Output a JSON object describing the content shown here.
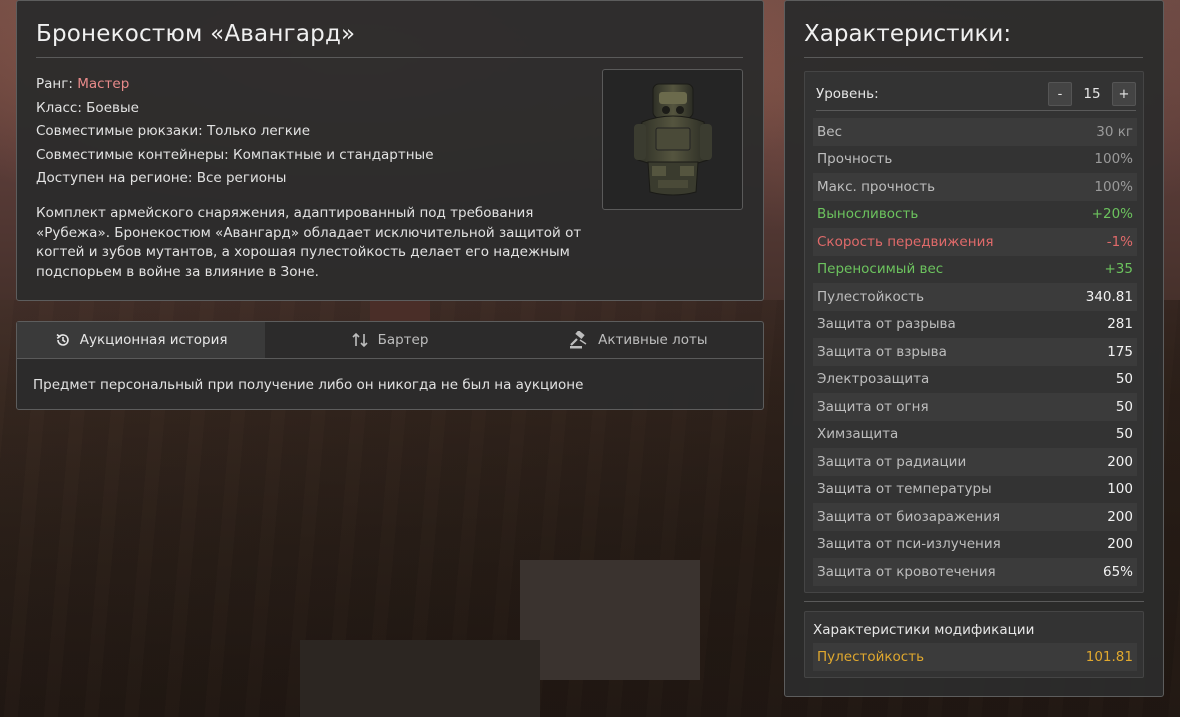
{
  "item": {
    "title": "Бронекостюм «Авангард»",
    "rank_label": "Ранг: ",
    "rank_value": "Мастер",
    "rank_color": "#e88a8a",
    "class_text": "Класс: Боевые",
    "backpacks_text": "Совместимые рюкзаки: Только легкие",
    "containers_text": "Совместимые контейнеры: Компактные и стандартные",
    "region_text": "Доступен на регионе: Все регионы",
    "description": "Комплект армейского снаряжения, адаптированный под требования «Рубежа». Бронекостюм «Авангард» обладает исключительной защитой от когтей и зубов мутантов, а хорошая пулестойкость делает его надежным подспорьем в войне за влияние в Зоне."
  },
  "tabs": [
    {
      "label": "Аукционная история",
      "icon": "history-icon"
    },
    {
      "label": "Бартер",
      "icon": "swap-arrows-icon"
    },
    {
      "label": "Активные лоты",
      "icon": "gavel-icon"
    }
  ],
  "tab_content": "Предмет персональный при получение либо он никогда не был на аукционе",
  "stats": {
    "title": "Характеристики:",
    "level_label": "Уровень:",
    "level_minus": "-",
    "level_value": "15",
    "level_plus": "+",
    "rows": [
      {
        "name": "Вес",
        "value": "30 кг",
        "style": "dim"
      },
      {
        "name": "Прочность",
        "value": "100%",
        "style": "dim"
      },
      {
        "name": "Макс. прочность",
        "value": "100%",
        "style": "dim"
      },
      {
        "name": "Выносливость",
        "value": "+20%",
        "style": "green"
      },
      {
        "name": "Скорость передвижения",
        "value": "-1%",
        "style": "red"
      },
      {
        "name": "Переносимый вес",
        "value": "+35",
        "style": "green"
      },
      {
        "name": "Пулестойкость",
        "value": "340.81",
        "style": "bright"
      },
      {
        "name": "Защита от разрыва",
        "value": "281",
        "style": "bright"
      },
      {
        "name": "Защита от взрыва",
        "value": "175",
        "style": "bright"
      },
      {
        "name": "Электрозащита",
        "value": "50",
        "style": "bright"
      },
      {
        "name": "Защита от огня",
        "value": "50",
        "style": "bright"
      },
      {
        "name": "Химзащита",
        "value": "50",
        "style": "bright"
      },
      {
        "name": "Защита от радиации",
        "value": "200",
        "style": "bright"
      },
      {
        "name": "Защита от температуры",
        "value": "100",
        "style": "bright"
      },
      {
        "name": "Защита от биозаражения",
        "value": "200",
        "style": "bright"
      },
      {
        "name": "Защита от пси-излучения",
        "value": "200",
        "style": "bright"
      },
      {
        "name": "Защита от кровотечения",
        "value": "65%",
        "style": "bright"
      }
    ],
    "mod_title": "Характеристики модификации",
    "mod_rows": [
      {
        "name": "Пулестойкость",
        "value": "101.81"
      }
    ],
    "colors": {
      "green": "#6cc35e",
      "red": "#e06a6a",
      "mod": "#e0a82e"
    }
  }
}
